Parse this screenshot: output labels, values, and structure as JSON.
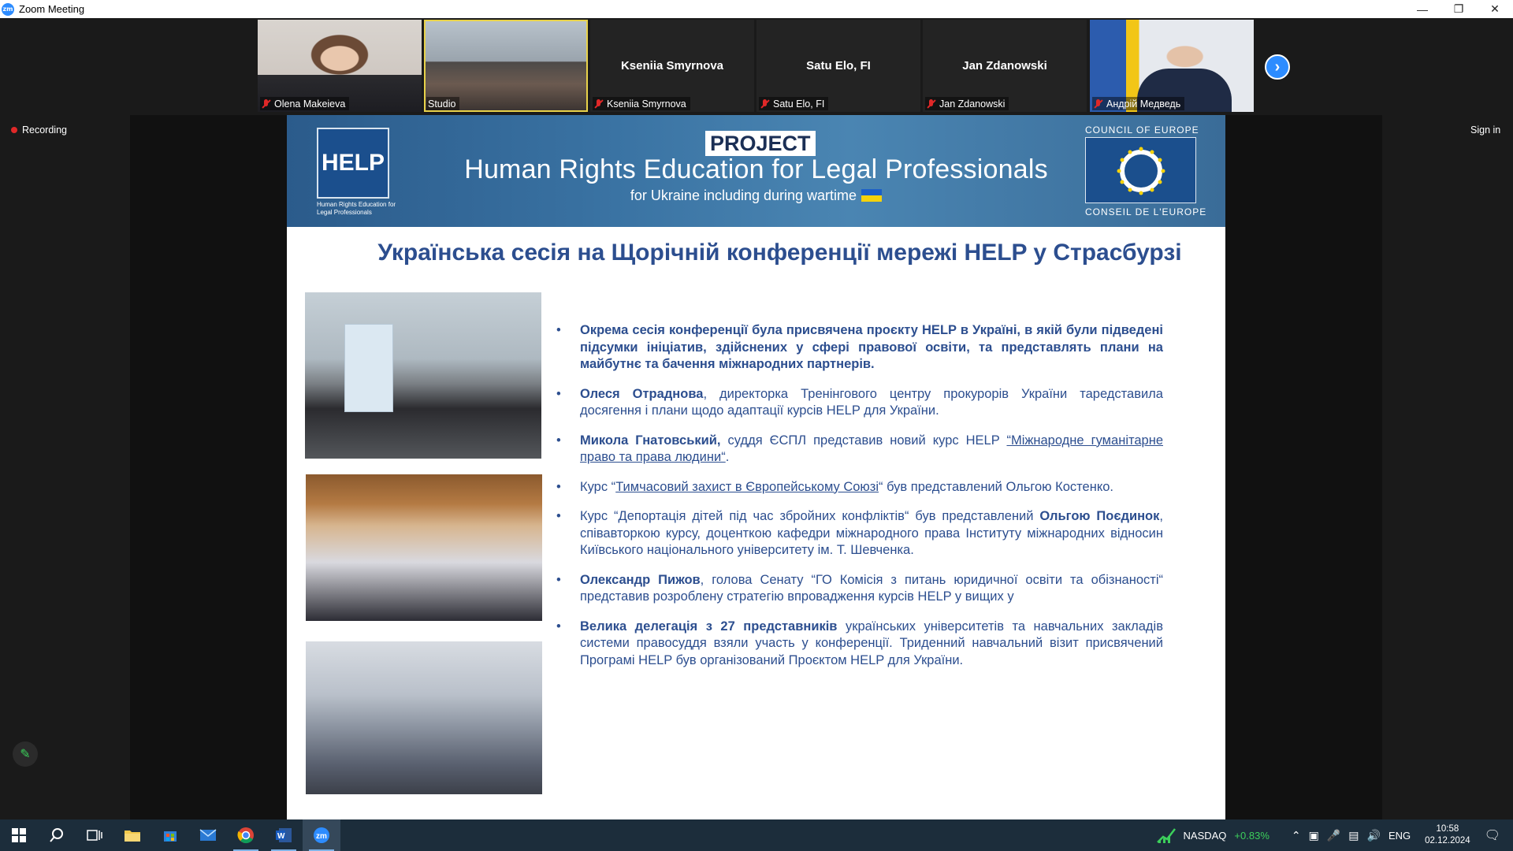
{
  "window": {
    "title": "Zoom Meeting",
    "logo": "zm"
  },
  "gallery": {
    "participants": [
      {
        "display": "",
        "label": "Olena Makeieva"
      },
      {
        "display": "",
        "label": "Studio"
      },
      {
        "display": "Kseniia Smyrnova",
        "label": "Kseniia Smyrnova"
      },
      {
        "display": "Satu Elo, FI",
        "label": "Satu Elo, FI"
      },
      {
        "display": "Jan Zdanowski",
        "label": "Jan Zdanowski"
      },
      {
        "display": "",
        "label": "Андрій Медведь"
      }
    ],
    "next_icon": "chevron-right-icon"
  },
  "status": {
    "recording": "Recording",
    "sign_in": "Sign in"
  },
  "slide": {
    "banner": {
      "help_logo": "HELP",
      "help_sub": "Human Rights Education for Legal Professionals",
      "project": "PROJECT",
      "title": "Human Rights Education for Legal Professionals",
      "subtitle": "for Ukraine including during wartime",
      "coe_top": "COUNCIL OF EUROPE",
      "coe_bottom": "CONSEIL DE L'EUROPE"
    },
    "title": "Українська сесія на Щорічній конференції мережі HELP у Страсбурзі",
    "bullets": {
      "b1": "Окрема сесія конференції  була присвячена проєкту HELP в Україні, в якій були підведені підсумки ініціатив, здійснених у сфері правової освіти, та представлять плани на майбутнє та бачення міжнародних партнерів.",
      "b2_name": "Олеся Отраднова",
      "b2_rest": ", директорка Тренінгового центру прокурорів України таредставила досягення і плани  щодо адаптації курсів HELP для України.",
      "b3_name": "Микола Гнатовський,",
      "b3_mid": " суддя ЄСПЛ представив новий курс HELP ",
      "b3_link": "“Міжнародне гуманітарне право та права людини“",
      "b3_end": ".",
      "b4_start": "Курс “",
      "b4_link": "Тимчасовий захист в Європейському Союзі",
      "b4_end": "“ був представлений Ольгою Костенко.",
      "b5_start": " Курс “Депортація дітей під час збройних конфліктів“ був представлений ",
      "b5_name": "Ольгою Поєдинок",
      "b5_end": ", співавторкою курсу, доценткою кафедри міжнародного права Інституту міжнародних відносин Київського національного університету ім. Т. Шевченка.",
      "b6_name": "Олександр Пижов",
      "b6_rest": ",   голова Сенату “ГО Комісія з питань юридичної освіти та обізнаності“ представив розроблену стратегію впровадження курсів HELP у вищих у",
      "b7_name": "Велика делегація з 27 представників",
      "b7_rest": " українських університетів та навчальних закладів системи правосуддя взяли участь у конференції. Триденний навчальний візит присвячений Програмі HELP був організований Проєктом HELP для України."
    }
  },
  "taskbar": {
    "stock_name": "NASDAQ",
    "stock_change": "+0.83%",
    "lang": "ENG",
    "time": "10:58",
    "date": "02.12.2024"
  }
}
